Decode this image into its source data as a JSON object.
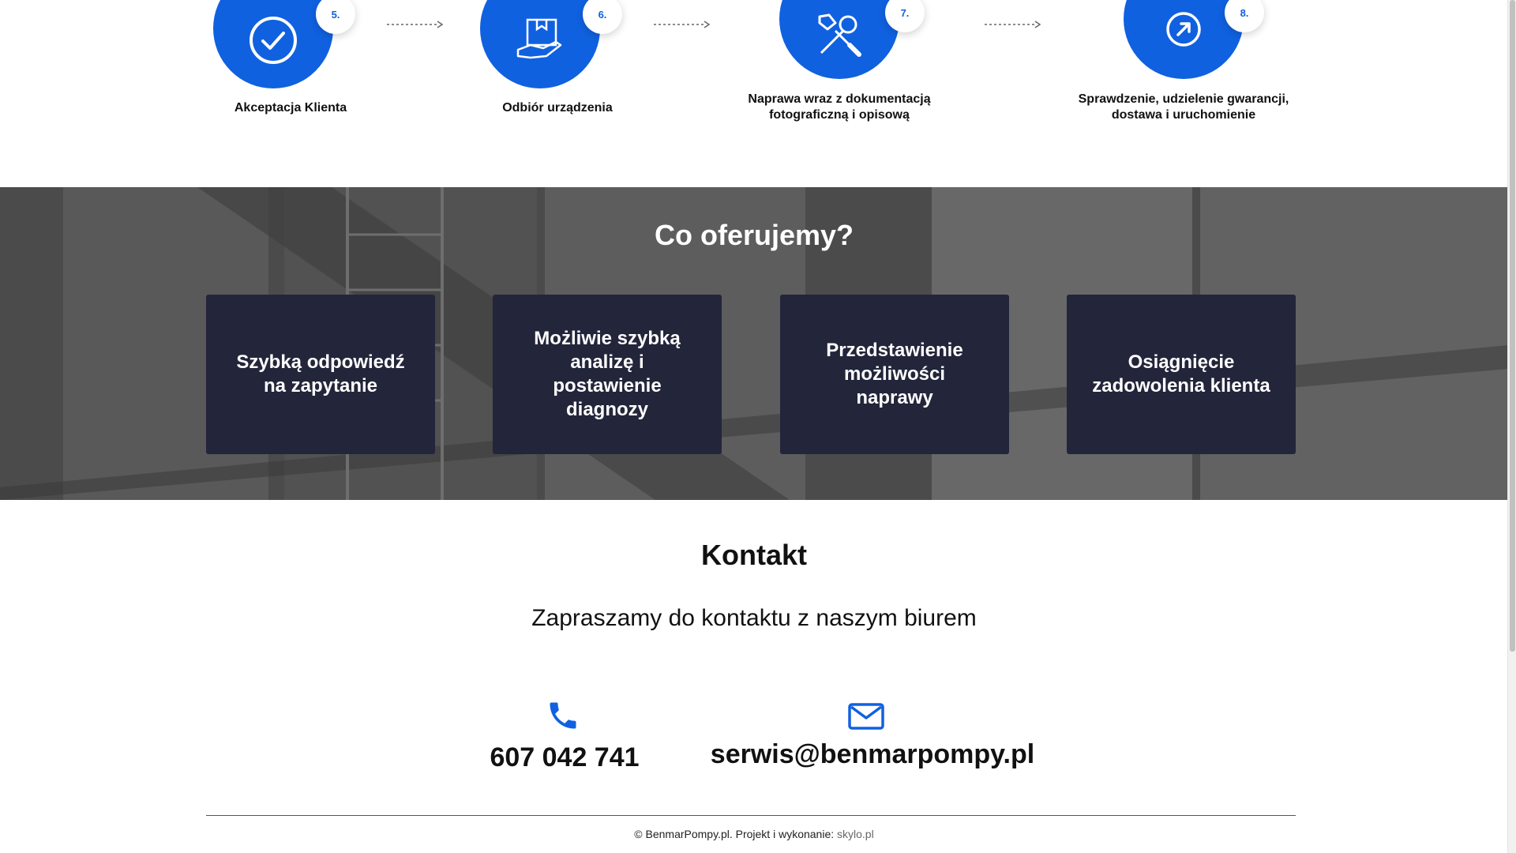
{
  "steps": [
    {
      "number": "5.",
      "label": "Akceptacja Klienta",
      "icon": "check-icon"
    },
    {
      "number": "6.",
      "label": "Odbiór urządzenia",
      "icon": "package-hand-icon"
    },
    {
      "number": "7.",
      "label_line1": "Naprawa wraz z dokumentacją",
      "label_line2": "fotograficzną i opisową",
      "icon": "tools-icon"
    },
    {
      "number": "8.",
      "label_line1": "Sprawdzenie, udzielenie gwarancji,",
      "label_line2": "dostawa i uruchomienie",
      "icon": "arrow-up-right-icon"
    }
  ],
  "offer": {
    "title": "Co oferujemy?",
    "cards": [
      "Szybką odpowiedź na zapytanie",
      "Możliwie szybką analizę i postawienie diagnozy",
      "Przedstawienie możliwości naprawy",
      "Osiągnięcie zadowolenia klienta"
    ]
  },
  "contact": {
    "title": "Kontakt",
    "subtitle": "Zapraszamy do kontaktu z naszym biurem",
    "phone": "607 042 741",
    "email": "serwis@benmarpompy.pl"
  },
  "footer": {
    "text": "© BenmarPompy.pl. Projekt i wykonanie: ",
    "link": "skylo.pl"
  },
  "colors": {
    "accent": "#1061e0",
    "card_bg": "#23253a"
  }
}
